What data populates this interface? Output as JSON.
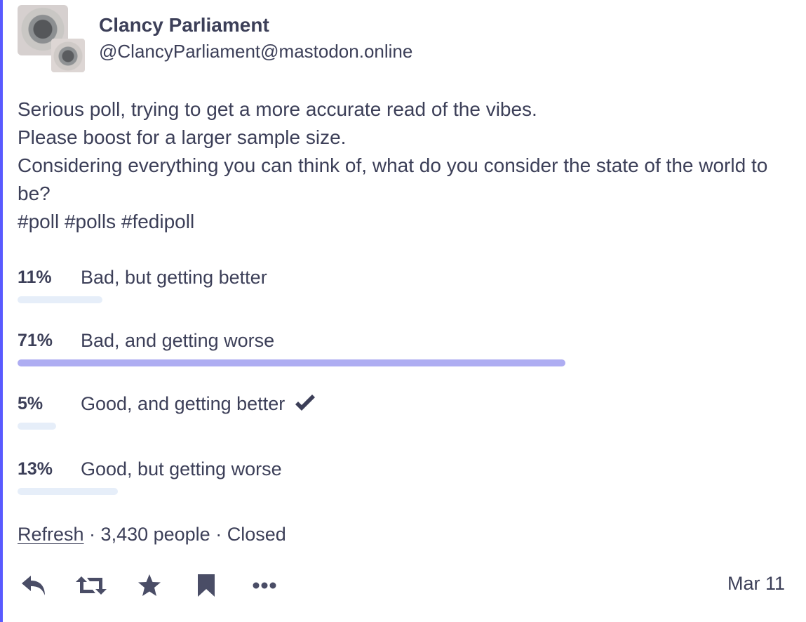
{
  "author": {
    "display_name": "Clancy Parliament",
    "account": "@ClancyParliament@mastodon.online"
  },
  "post": {
    "lines": [
      "Serious poll, trying to get a more accurate read of the vibes.",
      "Please boost for a larger sample size.",
      "Considering everything you can think of, what do you consider the state of the world to be?",
      "#poll #polls #fedipoll"
    ]
  },
  "poll": {
    "options": [
      {
        "percent_label": "11%",
        "percent": 11,
        "label": "Bad, but getting better",
        "leading": false,
        "voted": false
      },
      {
        "percent_label": "71%",
        "percent": 71,
        "label": "Bad, and getting worse",
        "leading": true,
        "voted": false
      },
      {
        "percent_label": "5%",
        "percent": 5,
        "label": "Good, and getting better",
        "leading": false,
        "voted": true
      },
      {
        "percent_label": "13%",
        "percent": 13,
        "label": "Good, but getting worse",
        "leading": false,
        "voted": false
      }
    ],
    "refresh_label": "Refresh",
    "separator": " · ",
    "voters": "3,430 people",
    "status": "Closed"
  },
  "actions": {
    "icons": [
      "reply-icon",
      "boost-icon",
      "favourite-icon",
      "bookmark-icon",
      "more-icon"
    ]
  },
  "date": "Mar 11",
  "colors": {
    "accent": "#595aff",
    "text": "#3c3f58",
    "bar": "#e6eef9",
    "bar_leading": "#aeadf2"
  }
}
